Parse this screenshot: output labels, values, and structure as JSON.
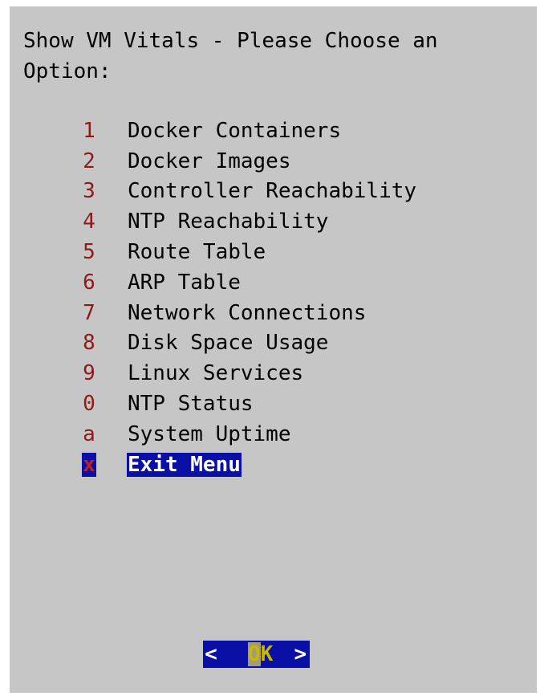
{
  "dialog": {
    "title": "Show VM Vitals - Please Choose an\nOption:",
    "menu": [
      {
        "key": "1",
        "label": "Docker Containers",
        "selected": false
      },
      {
        "key": "2",
        "label": "Docker Images",
        "selected": false
      },
      {
        "key": "3",
        "label": "Controller Reachability",
        "selected": false
      },
      {
        "key": "4",
        "label": "NTP Reachability",
        "selected": false
      },
      {
        "key": "5",
        "label": "Route Table",
        "selected": false
      },
      {
        "key": "6",
        "label": "ARP Table",
        "selected": false
      },
      {
        "key": "7",
        "label": "Network Connections",
        "selected": false
      },
      {
        "key": "8",
        "label": "Disk Space Usage",
        "selected": false
      },
      {
        "key": "9",
        "label": "Linux Services",
        "selected": false
      },
      {
        "key": "0",
        "label": "NTP Status",
        "selected": false
      },
      {
        "key": "a",
        "label": "System Uptime",
        "selected": false
      },
      {
        "key": "x",
        "label": "Exit Menu",
        "selected": true
      }
    ],
    "ok_button": {
      "left_bracket": "<",
      "hotkey": "O",
      "rest": "K",
      "right_bracket": ">"
    }
  },
  "colors": {
    "background": "#c6c6c6",
    "menu_key": "#8e1a1a",
    "selection": "#0a0fa6",
    "selected_text": "#ffffff",
    "button_text": "#c8b800"
  }
}
